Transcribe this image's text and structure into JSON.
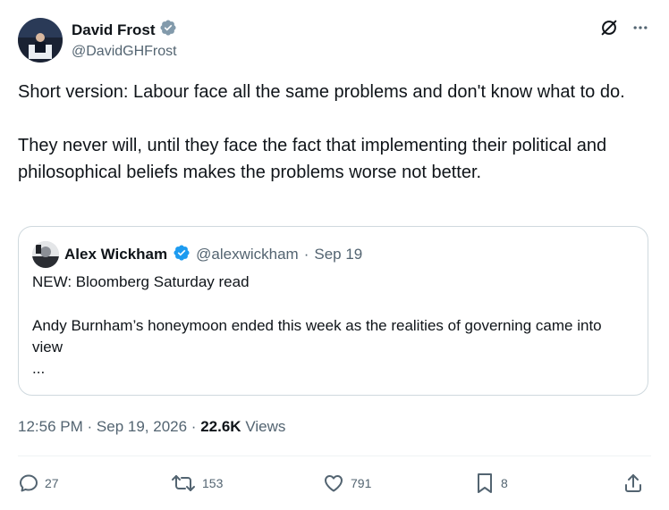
{
  "tweet": {
    "author": {
      "name": "David Frost",
      "handle": "@DavidGHFrost",
      "verified": true
    },
    "paragraphs": [
      "Short version:  Labour face all the same problems and don't know what to do.",
      "They never will, until they face the fact that implementing their political and philosophical beliefs makes the problems worse not better."
    ],
    "time": "12:56 PM",
    "date": "Sep 19, 2026",
    "views_count": "22.6K",
    "views_label": "Views",
    "sep": "·"
  },
  "quote": {
    "name": "Alex Wickham",
    "handle": "@alexwickham",
    "date": "Sep 19",
    "sep": "·",
    "verified": true,
    "line1": "NEW: Bloomberg Saturday read",
    "line2": "Andy Burnham’s honeymoon ended this week as the realities of governing came into view",
    "line3": "..."
  },
  "actions": {
    "replies": "27",
    "reposts": "153",
    "likes": "791",
    "bookmarks": "8"
  },
  "icons": {
    "verified": "verified-badge-icon",
    "grok": "grok-icon",
    "more": "more-icon",
    "reply": "reply-icon",
    "repost": "repost-icon",
    "like": "heart-icon",
    "bookmark": "bookmark-icon",
    "share": "share-icon"
  },
  "colors": {
    "accent": "#1d9bf0",
    "muted": "#536471",
    "text": "#0f1419",
    "verified_gray": "#829aab"
  }
}
